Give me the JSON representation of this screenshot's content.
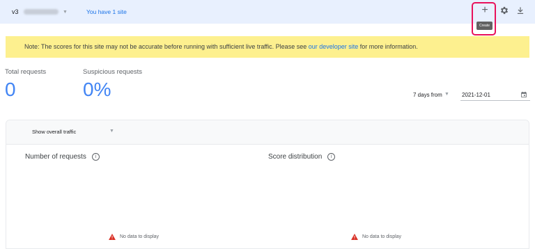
{
  "header": {
    "version": "v3",
    "site_count_text": "You have 1 site",
    "create_tooltip": "Create"
  },
  "note": {
    "prefix": "Note: The scores for this site may not be accurate before running with sufficient live traffic. Please see ",
    "link_text": "our developer site",
    "suffix": " for more information."
  },
  "stats": {
    "total_label": "Total requests",
    "total_value": "0",
    "suspicious_label": "Suspicious requests",
    "suspicious_value": "0%"
  },
  "date_range": {
    "range_label": "7 days from",
    "date_value": "2021-12-01"
  },
  "panel": {
    "traffic_select": "Show overall traffic",
    "charts": [
      {
        "title": "Number of requests",
        "empty_text": "No data to display"
      },
      {
        "title": "Score distribution",
        "empty_text": "No data to display"
      }
    ]
  },
  "colors": {
    "accent": "#1a73e8",
    "stat_blue": "#4285f4",
    "note_bg": "#fdf08f",
    "highlight": "#e8115b",
    "warning": "#d93025"
  },
  "icons": [
    "plus-icon",
    "gear-icon",
    "download-icon",
    "calendar-icon",
    "info-icon",
    "warning-icon",
    "chevron-down-icon"
  ]
}
